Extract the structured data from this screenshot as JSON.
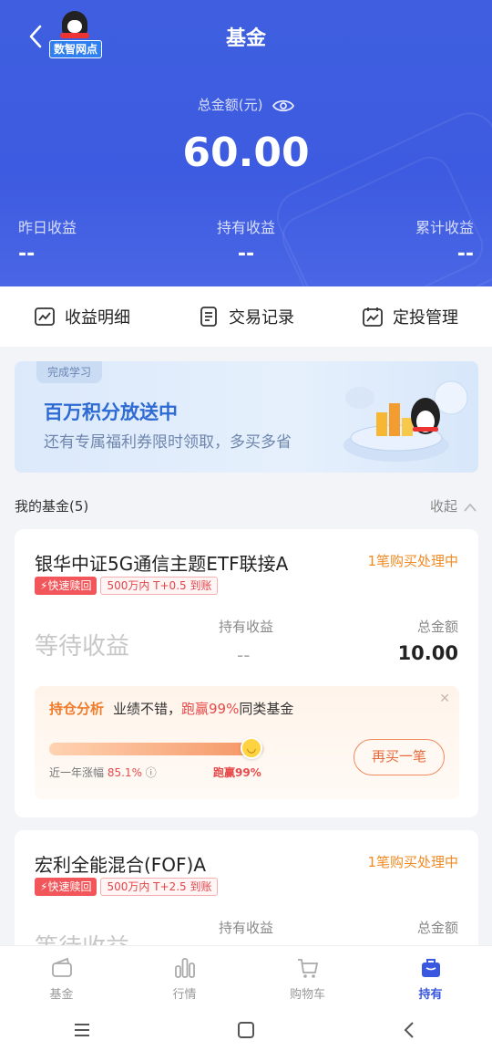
{
  "header": {
    "title": "基金",
    "logo_text": "数智网点",
    "total_label": "总金额(元)",
    "total_amount": "60.00",
    "stats": [
      {
        "label": "昨日收益",
        "value": "--"
      },
      {
        "label": "持有收益",
        "value": "--"
      },
      {
        "label": "累计收益",
        "value": "--"
      }
    ],
    "colors": {
      "primary": "#3f5fe0"
    }
  },
  "actions": [
    {
      "label": "收益明细",
      "icon": "chart-icon"
    },
    {
      "label": "交易记录",
      "icon": "document-icon"
    },
    {
      "label": "定投管理",
      "icon": "calendar-trend-icon"
    }
  ],
  "banner": {
    "chip": "完成学习",
    "headline": "百万积分放送中",
    "subline": "还有专属福利券限时领取，多买多省"
  },
  "funds_section": {
    "title": "我的基金(5)",
    "collapse_label": "收起"
  },
  "funds": [
    {
      "name": "银华中证5G通信主题ETF联接A",
      "status": "1笔购买处理中",
      "tag_fast": "快速赎回",
      "tag_time": "500万内 T+0.5 到账",
      "waiting": "等待收益",
      "hold_label": "持有收益",
      "hold_value": "--",
      "total_label": "总金额",
      "total_value": "10.00",
      "analysis": {
        "label": "持仓分析",
        "text_prefix": "业绩不错，",
        "text_highlight": "跑赢99%",
        "text_suffix": "同类基金",
        "year_label": "近一年涨幅",
        "year_value": "85.1%",
        "beat": "跑赢99%",
        "beat_fraction": 0.99,
        "rebuy": "再买一笔"
      }
    },
    {
      "name": "宏利全能混合(FOF)A",
      "status": "1笔购买处理中",
      "tag_fast": "快速赎回",
      "tag_time": "500万内 T+2.5 到账",
      "waiting": "等待收益",
      "hold_label": "持有收益",
      "total_label": "总金额"
    }
  ],
  "tabbar": [
    {
      "label": "基金",
      "icon": "wallet-icon",
      "active": false
    },
    {
      "label": "行情",
      "icon": "bar-chart-icon",
      "active": false
    },
    {
      "label": "购物车",
      "icon": "cart-icon",
      "active": false
    },
    {
      "label": "持有",
      "icon": "briefcase-icon",
      "active": true
    }
  ]
}
